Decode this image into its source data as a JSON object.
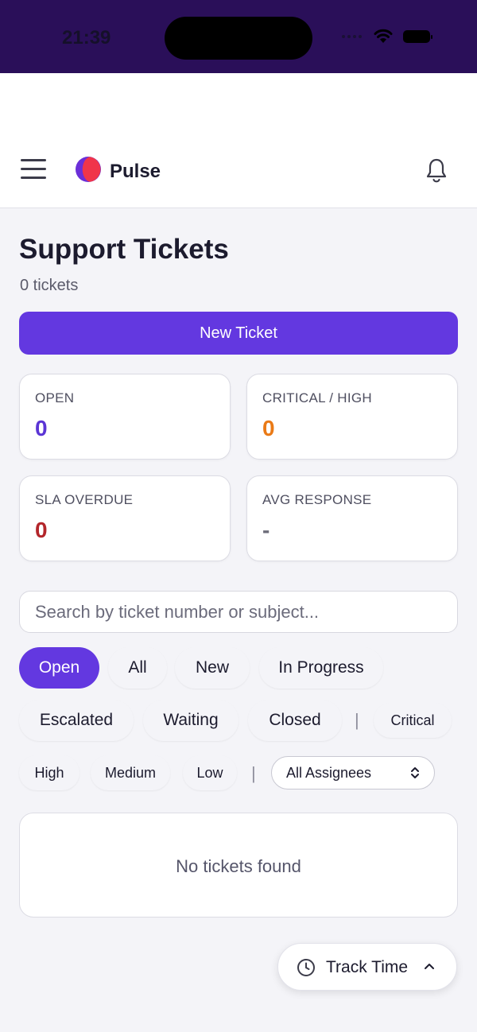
{
  "status_bar": {
    "time": "21:39"
  },
  "app": {
    "name": "Pulse"
  },
  "page": {
    "title": "Support Tickets",
    "ticket_count": "0 tickets",
    "new_ticket_label": "New Ticket"
  },
  "stats": [
    {
      "label": "OPEN",
      "value": "0",
      "color": "#5b35d5"
    },
    {
      "label": "CRITICAL / HIGH",
      "value": "0",
      "color": "#ea7a16"
    },
    {
      "label": "SLA OVERDUE",
      "value": "0",
      "color": "#b3262b"
    },
    {
      "label": "AVG RESPONSE",
      "value": "-",
      "color": "#6b6b78"
    }
  ],
  "search": {
    "placeholder": "Search by ticket number or subject..."
  },
  "status_filters": [
    "Open",
    "All",
    "New",
    "In Progress",
    "Escalated",
    "Waiting",
    "Closed"
  ],
  "priority_filters": [
    "Critical",
    "High",
    "Medium",
    "Low"
  ],
  "divider": "|",
  "assignee_filter": {
    "selected": "All Assignees"
  },
  "empty_state": {
    "message": "No tickets found"
  },
  "track_time": {
    "label": "Track Time"
  },
  "colors": {
    "accent": "#6338e0",
    "status_bar": "#2a0f59"
  }
}
